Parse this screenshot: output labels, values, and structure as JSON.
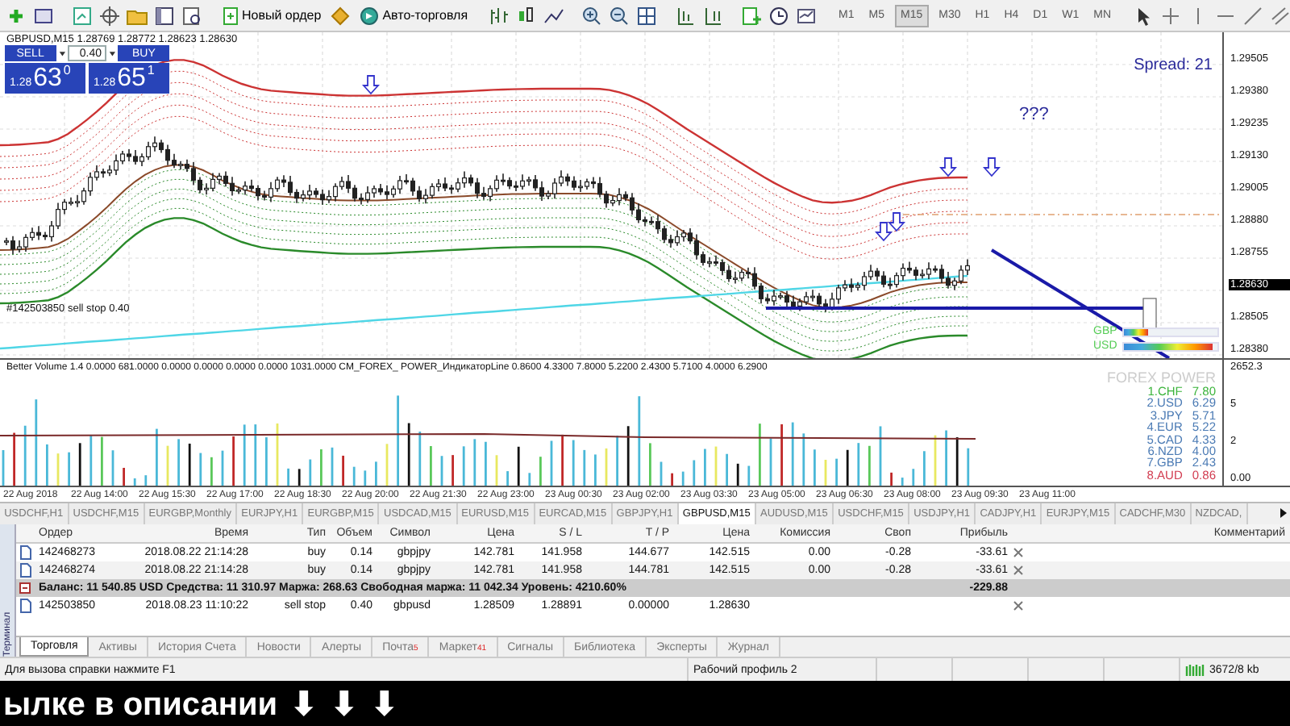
{
  "toolbar": {
    "buttons": [
      {
        "label": "Новый ордер"
      },
      {
        "label": "Авто-торговля"
      }
    ],
    "timeframes": [
      {
        "label": "M1",
        "selected": false
      },
      {
        "label": "M5",
        "selected": false
      },
      {
        "label": "M15",
        "selected": true
      },
      {
        "label": "M30",
        "selected": false
      },
      {
        "label": "H1",
        "selected": false
      },
      {
        "label": "H4",
        "selected": false
      },
      {
        "label": "D1",
        "selected": false
      },
      {
        "label": "W1",
        "selected": false
      },
      {
        "label": "MN",
        "selected": false
      }
    ]
  },
  "chart": {
    "header": "GBPUSD,M15  1.28769 1.28772 1.28623 1.28630",
    "trade_panel": {
      "sell": "SELL",
      "lot": "0.40",
      "buy": "BUY",
      "sell_price": {
        "prefix": "1.28",
        "big": "63",
        "sup": "0"
      },
      "buy_price": {
        "prefix": "1.28",
        "big": "65",
        "sup": "1"
      }
    },
    "spread": "Spread: 21",
    "note": "???",
    "order_label": "#142503850 sell stop 0.40",
    "price_axis": [
      {
        "label": "1.29505",
        "current": false
      },
      {
        "label": "1.29380",
        "current": false
      },
      {
        "label": "1.29235",
        "current": false
      },
      {
        "label": "1.29130",
        "current": false
      },
      {
        "label": "1.29005",
        "current": false
      },
      {
        "label": "1.28880",
        "current": false
      },
      {
        "label": "1.28755",
        "current": false
      },
      {
        "label": "1.28630",
        "current": true
      },
      {
        "label": "1.28505",
        "current": false
      },
      {
        "label": "1.28380",
        "current": false
      }
    ],
    "currency_bars": [
      {
        "label": "GBP",
        "level": 0.25
      },
      {
        "label": "USD",
        "level": 0.95
      }
    ]
  },
  "indicator": {
    "header": "Better Volume 1.4 0.0000 681.0000 0.0000 0.0000 0.0000 0.0000 1031.0000  CM_FOREX_ POWER_ИндикаторLine 0.8600 4.3300 7.8000 5.2200 2.4300 5.7100 4.0000 6.2900",
    "axis": [
      "2652.3",
      "5",
      "2",
      "0.00"
    ],
    "forex_power": {
      "title": "FOREX POWER",
      "items": [
        {
          "label": "1.CHF",
          "value": "7.80",
          "color": "#3cb43c"
        },
        {
          "label": "2.USD",
          "value": "6.29",
          "color": "#4a7ab4"
        },
        {
          "label": "3.JPY",
          "value": "5.71",
          "color": "#4a7ab4"
        },
        {
          "label": "4.EUR",
          "value": "5.22",
          "color": "#4a7ab4"
        },
        {
          "label": "5.CAD",
          "value": "4.33",
          "color": "#4a7ab4"
        },
        {
          "label": "6.NZD",
          "value": "4.00",
          "color": "#4a7ab4"
        },
        {
          "label": "7.GBP",
          "value": "2.43",
          "color": "#4a7ab4"
        },
        {
          "label": "8.AUD",
          "value": "0.86",
          "color": "#d23c50"
        }
      ]
    }
  },
  "time_axis": [
    "22 Aug 2018",
    "22 Aug 14:00",
    "22 Aug 15:30",
    "22 Aug 17:00",
    "22 Aug 18:30",
    "22 Aug 20:00",
    "22 Aug 21:30",
    "22 Aug 23:00",
    "23 Aug 00:30",
    "23 Aug 02:00",
    "23 Aug 03:30",
    "23 Aug 05:00",
    "23 Aug 06:30",
    "23 Aug 08:00",
    "23 Aug 09:30",
    "23 Aug 11:00"
  ],
  "symbol_tabs": [
    {
      "label": "USDCHF,H1",
      "selected": false
    },
    {
      "label": "USDCHF,M15",
      "selected": false
    },
    {
      "label": "EURGBP,Monthly",
      "selected": false
    },
    {
      "label": "EURJPY,H1",
      "selected": false
    },
    {
      "label": "EURGBP,M15",
      "selected": false
    },
    {
      "label": "USDCAD,M15",
      "selected": false
    },
    {
      "label": "EURUSD,M15",
      "selected": false
    },
    {
      "label": "EURCAD,M15",
      "selected": false
    },
    {
      "label": "GBPJPY,H1",
      "selected": false
    },
    {
      "label": "GBPUSD,M15",
      "selected": true
    },
    {
      "label": "AUDUSD,M15",
      "selected": false
    },
    {
      "label": "USDCHF,M15",
      "selected": false
    },
    {
      "label": "USDJPY,H1",
      "selected": false
    },
    {
      "label": "CADJPY,H1",
      "selected": false
    },
    {
      "label": "EURJPY,M15",
      "selected": false
    },
    {
      "label": "CADCHF,M30",
      "selected": false
    },
    {
      "label": "NZDCAD,",
      "selected": false
    }
  ],
  "terminal": {
    "side_label": "Терминал",
    "columns": [
      "Ордер",
      "Время",
      "Тип",
      "Объем",
      "Символ",
      "Цена",
      "S / L",
      "T / P",
      "Цена",
      "Комиссия",
      "Своп",
      "Прибыль",
      "Комментарий"
    ],
    "rows": [
      {
        "kind": "position",
        "cells": [
          "142468273",
          "2018.08.22 21:14:28",
          "buy",
          "0.14",
          "gbpjpy",
          "142.781",
          "141.958",
          "144.677",
          "142.515",
          "0.00",
          "-0.28",
          "-33.61"
        ]
      },
      {
        "kind": "position",
        "cells": [
          "142468274",
          "2018.08.22 21:14:28",
          "buy",
          "0.14",
          "gbpjpy",
          "142.781",
          "141.958",
          "144.781",
          "142.515",
          "0.00",
          "-0.28",
          "-33.61"
        ]
      },
      {
        "kind": "summary",
        "text": "Баланс: 11 540.85 USD  Средства: 11 310.97  Маржа: 268.63  Свободная маржа: 11 042.34  Уровень: 4210.60%",
        "profit": "-229.88"
      },
      {
        "kind": "pending",
        "cells": [
          "142503850",
          "2018.08.23 11:10:22",
          "sell stop",
          "0.40",
          "gbpusd",
          "1.28509",
          "1.28891",
          "0.00000",
          "1.28630",
          "",
          "",
          ""
        ]
      }
    ],
    "tabs": [
      {
        "label": "Торговля",
        "selected": true
      },
      {
        "label": "Активы",
        "selected": false
      },
      {
        "label": "История Счета",
        "selected": false
      },
      {
        "label": "Новости",
        "selected": false
      },
      {
        "label": "Алерты",
        "selected": false
      },
      {
        "label": "Почта",
        "badge": "5",
        "selected": false
      },
      {
        "label": "Маркет",
        "badge": "41",
        "selected": false
      },
      {
        "label": "Сигналы",
        "selected": false
      },
      {
        "label": "Библиотека",
        "selected": false
      },
      {
        "label": "Эксперты",
        "selected": false
      },
      {
        "label": "Журнал",
        "selected": false
      }
    ]
  },
  "status_bar": {
    "help": "Для вызова справки нажмите F1",
    "profile": "Рабочий профиль 2",
    "traffic": "3672/8 kb"
  },
  "subtitle": {
    "text": "ылке в описании",
    "arrows": [
      "⬇",
      "⬇",
      "⬇"
    ]
  }
}
